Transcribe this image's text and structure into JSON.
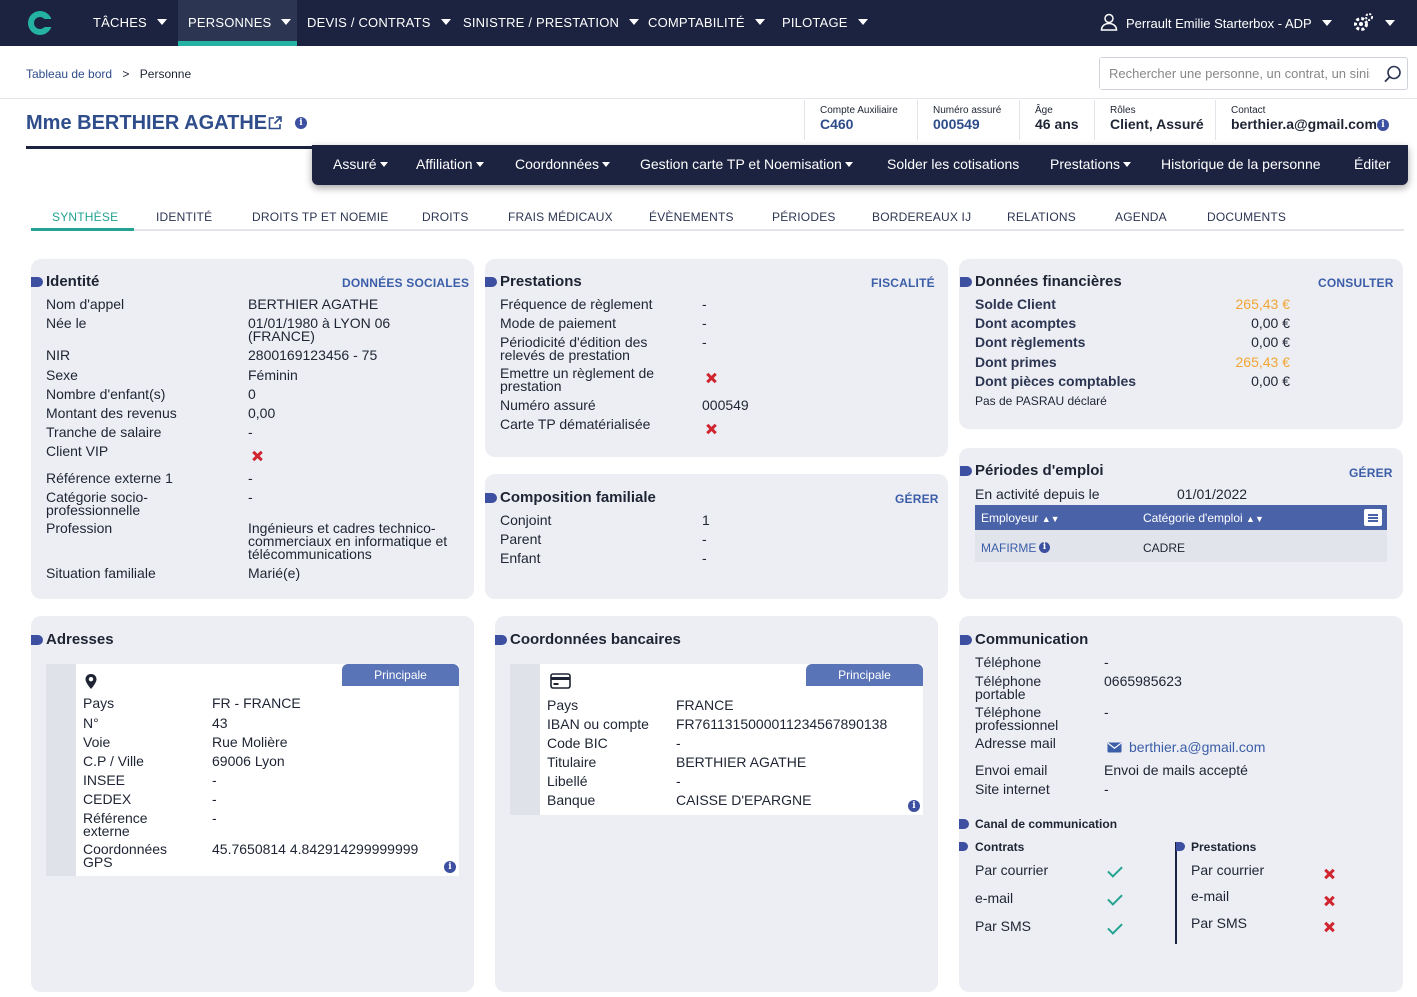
{
  "nav": {
    "items": [
      "TÂCHES",
      "PERSONNES",
      "DEVIS / CONTRATS",
      "SINISTRE / PRESTATION",
      "COMPTABILITÉ",
      "PILOTAGE"
    ],
    "user": "Perrault Emilie Starterbox - ADP"
  },
  "breadcrumb": {
    "home": "Tableau de bord",
    "sep": ">",
    "current": "Personne"
  },
  "search": {
    "placeholder": "Rechercher une personne, un contrat, un sinistre"
  },
  "person": {
    "name": "Mme BERTHIER AGATHE"
  },
  "summary": [
    {
      "k": "Compte Auxiliaire",
      "v": "C460"
    },
    {
      "k": "Numéro assuré",
      "v": "000549"
    },
    {
      "k": "Âge",
      "v": "46 ans"
    },
    {
      "k": "Rôles",
      "v": "Client, Assuré"
    },
    {
      "k": "Contact",
      "v": "berthier.a@gmail.com"
    }
  ],
  "menubar": [
    "Assuré",
    "Affiliation",
    "Coordonnées",
    "Gestion carte TP et Noemisation",
    "Solder les cotisations",
    "Prestations",
    "Historique de la personne",
    "Éditer"
  ],
  "tabs": [
    "SYNTHÈSE",
    "IDENTITÉ",
    "DROITS TP ET NOEMIE",
    "DROITS",
    "FRAIS MÉDICAUX",
    "ÉVÈNEMENTS",
    "PÉRIODES",
    "BORDEREAUX IJ",
    "RELATIONS",
    "AGENDA",
    "DOCUMENTS"
  ],
  "identite": {
    "title": "Identité",
    "action": "DONNÉES SOCIALES",
    "rows": [
      {
        "l": "Nom d'appel",
        "v": "BERTHIER AGATHE"
      },
      {
        "l": "Née le",
        "v": "01/01/1980 à LYON 06",
        "v2": "(FRANCE)"
      },
      {
        "l": "NIR",
        "v": "2800169123456 - 75"
      },
      {
        "l": "Sexe",
        "v": "Féminin"
      },
      {
        "l": "Nombre d'enfant(s)",
        "v": "0"
      },
      {
        "l": "Montant des revenus",
        "v": "0,00"
      },
      {
        "l": "Tranche de salaire",
        "v": "-"
      },
      {
        "l": "Client VIP",
        "v": ""
      },
      {
        "l": "Référence externe 1",
        "v": "-"
      },
      {
        "l": "Catégorie socio-",
        "l2": "professionnelle",
        "v": "-"
      },
      {
        "l": "Profession",
        "v": "Ingénieurs et cadres technico-",
        "v2": "commerciaux en informatique et",
        "v3": "télécommunications"
      },
      {
        "l": "Situation familiale",
        "v": "Marié(e)"
      }
    ]
  },
  "prestations": {
    "title": "Prestations",
    "action": "FISCALITÉ",
    "rows": [
      {
        "l": "Fréquence de règlement",
        "v": "-"
      },
      {
        "l": "Mode de paiement",
        "v": "-"
      },
      {
        "l": "Périodicité d'édition des",
        "l2": "relevés de prestation",
        "v": "-"
      },
      {
        "l": "Emettre un règlement de",
        "l2": "prestation",
        "v": ""
      },
      {
        "l": "Numéro assuré",
        "v": "000549"
      },
      {
        "l": "Carte TP dématérialisée",
        "v": ""
      }
    ]
  },
  "finances": {
    "title": "Données financières",
    "action": "CONSULTER",
    "rows": [
      {
        "l": "Solde Client",
        "v": "265,43 €"
      },
      {
        "l": "Dont acomptes",
        "v": "0,00 €"
      },
      {
        "l": "Dont règlements",
        "v": "0,00 €"
      },
      {
        "l": "Dont primes",
        "v": "265,43 €"
      },
      {
        "l": "Dont pièces comptables",
        "v": "0,00 €"
      }
    ],
    "note": "Pas de PASRAU déclaré"
  },
  "composition": {
    "title": "Composition familiale",
    "action": "GÉRER",
    "rows": [
      {
        "l": "Conjoint",
        "v": "1"
      },
      {
        "l": "Parent",
        "v": "-"
      },
      {
        "l": "Enfant",
        "v": "-"
      }
    ]
  },
  "periodes": {
    "title": "Périodes d'emploi",
    "action": "GÉRER",
    "since_label": "En activité depuis le",
    "since": "01/01/2022",
    "cols": [
      "Employeur",
      "Catégorie d'emploi"
    ],
    "row": {
      "employeur": "MAFIRME",
      "categorie": "CADRE"
    }
  },
  "adresses": {
    "title": "Adresses",
    "badge": "Principale",
    "rows": [
      {
        "l": "Pays",
        "v": "FR - FRANCE"
      },
      {
        "l": "N°",
        "v": "43"
      },
      {
        "l": "Voie",
        "v": "Rue Molière"
      },
      {
        "l": "C.P / Ville",
        "v": "69006 Lyon"
      },
      {
        "l": "INSEE",
        "v": "-"
      },
      {
        "l": "CEDEX",
        "v": "-"
      },
      {
        "l": "Référence",
        "l2": "externe",
        "v": "-"
      },
      {
        "l": "Coordonnées",
        "l2": "GPS",
        "v": "45.7650814 4.842914299999999"
      }
    ]
  },
  "banque": {
    "title": "Coordonnées bancaires",
    "badge": "Principale",
    "rows": [
      {
        "l": "Pays",
        "v": "FRANCE"
      },
      {
        "l": "IBAN ou compte",
        "v": "FR7611315000011234567890138"
      },
      {
        "l": "Code BIC",
        "v": "-"
      },
      {
        "l": "Titulaire",
        "v": "BERTHIER AGATHE"
      },
      {
        "l": "Libellé",
        "v": "-"
      },
      {
        "l": "Banque",
        "v": "CAISSE D'EPARGNE"
      }
    ]
  },
  "communication": {
    "title": "Communication",
    "rows": [
      {
        "l": "Téléphone",
        "v": "-"
      },
      {
        "l": "Téléphone",
        "l2": "portable",
        "v": "0665985623"
      },
      {
        "l": "Téléphone",
        "l2": "professionnel",
        "v": "-"
      },
      {
        "l": "Adresse mail",
        "v": "berthier.a@gmail.com"
      },
      {
        "l": "Envoi email",
        "v": "Envoi de mails accepté"
      },
      {
        "l": "Site internet",
        "v": "-"
      }
    ],
    "canal_title": "Canal de communication",
    "contrats": {
      "title": "Contrats",
      "items": [
        "Par courrier",
        "e-mail",
        "Par SMS"
      ]
    },
    "prestations": {
      "title": "Prestations",
      "items": [
        "Par courrier",
        "e-mail",
        "Par SMS"
      ]
    }
  },
  "colors": {
    "navy": "#1c2340",
    "teal": "#24b3a3",
    "accent": "#3c4fa0",
    "red": "#d0252f",
    "orange": "#f2a535"
  }
}
